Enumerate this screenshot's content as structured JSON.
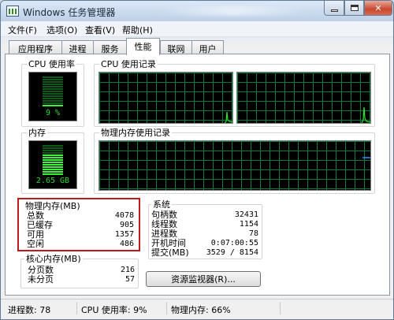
{
  "window": {
    "title": "Windows 任务管理器"
  },
  "menu": [
    "文件(F)",
    "选项(O)",
    "查看(V)",
    "帮助(H)"
  ],
  "tabs": [
    "应用程序",
    "进程",
    "服务",
    "性能",
    "联网",
    "用户"
  ],
  "active_tab": "性能",
  "groups": {
    "cpu_usage": "CPU 使用率",
    "cpu_history": "CPU 使用记录",
    "mem": "内存",
    "mem_history": "物理内存使用记录"
  },
  "meters": {
    "cpu_value": "9 %",
    "cpu_level": 0.09,
    "mem_value": "2.65 GB",
    "mem_level": 0.66
  },
  "physical_memory": {
    "title": "物理内存(MB)",
    "rows": [
      {
        "k": "总数",
        "v": "4078"
      },
      {
        "k": "已缓存",
        "v": "905"
      },
      {
        "k": "可用",
        "v": "1357"
      },
      {
        "k": "空闲",
        "v": "486"
      }
    ]
  },
  "kernel_memory": {
    "title": "核心内存(MB)",
    "rows": [
      {
        "k": "分页数",
        "v": "216"
      },
      {
        "k": "未分页",
        "v": "57"
      }
    ]
  },
  "system": {
    "title": "系统",
    "rows": [
      {
        "k": "句柄数",
        "v": "32431"
      },
      {
        "k": "线程数",
        "v": "1154"
      },
      {
        "k": "进程数",
        "v": "78"
      },
      {
        "k": "开机时间",
        "v": "0:07:00:55"
      },
      {
        "k": "提交(MB)",
        "v": "3529 / 8154"
      }
    ]
  },
  "resource_monitor_button": "资源监视器(R)...",
  "statusbar": {
    "processes": "进程数: 78",
    "cpu": "CPU 使用率: 9%",
    "memory": "物理内存: 66%"
  }
}
